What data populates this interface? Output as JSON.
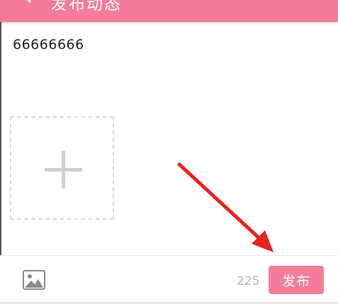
{
  "header": {
    "title": "发布动态",
    "back_icon": "chevron-left-icon",
    "background_color": "#f47c9a"
  },
  "post": {
    "text": "66666666"
  },
  "attachments": {
    "add_icon": "plus-icon"
  },
  "toolbar": {
    "image_icon": "image-icon",
    "remaining_chars": "225",
    "publish_label": "发布",
    "accent_color": "#f47c9a"
  },
  "annotation": {
    "arrow_color": "#e8231f",
    "arrow_icon": "red-arrow"
  }
}
